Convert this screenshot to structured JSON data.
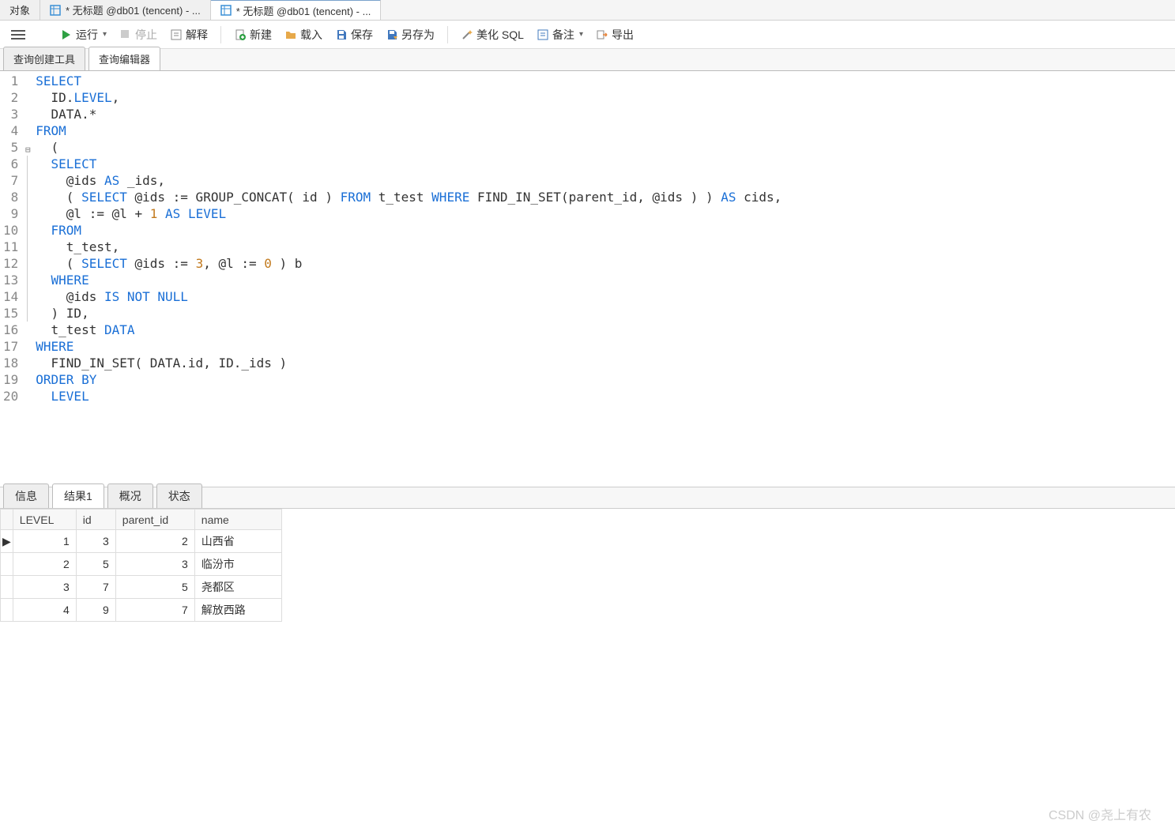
{
  "top_tabs": {
    "t0": "对象",
    "t1": "* 无标题 @db01 (tencent) - ...",
    "t2": "* 无标题 @db01 (tencent) - ..."
  },
  "toolbar": {
    "run": "运行",
    "stop": "停止",
    "explain": "解释",
    "new": "新建",
    "load": "载入",
    "save": "保存",
    "save_as": "另存为",
    "beautify": "美化 SQL",
    "remark": "备注",
    "export": "导出"
  },
  "sub_tabs": {
    "builder": "查询创建工具",
    "editor": "查询编辑器"
  },
  "code_lines": 20,
  "code_tokens": [
    [
      [
        "kw",
        "SELECT"
      ]
    ],
    [
      [
        "txt",
        "  ID."
      ],
      [
        "kw",
        "LEVEL"
      ],
      [
        "txt",
        ","
      ]
    ],
    [
      [
        "txt",
        "  DATA.*"
      ]
    ],
    [
      [
        "kw",
        "FROM"
      ]
    ],
    [
      [
        "txt",
        "  ("
      ]
    ],
    [
      [
        "txt",
        "  "
      ],
      [
        "kw",
        "SELECT"
      ]
    ],
    [
      [
        "txt",
        "    @ids "
      ],
      [
        "kw",
        "AS"
      ],
      [
        "txt",
        " _ids,"
      ]
    ],
    [
      [
        "txt",
        "    ( "
      ],
      [
        "kw",
        "SELECT"
      ],
      [
        "txt",
        " @ids := GROUP_CONCAT( id ) "
      ],
      [
        "kw",
        "FROM"
      ],
      [
        "txt",
        " t_test "
      ],
      [
        "kw",
        "WHERE"
      ],
      [
        "txt",
        " FIND_IN_SET(parent_id, @ids ) ) "
      ],
      [
        "kw",
        "AS"
      ],
      [
        "txt",
        " cids,"
      ]
    ],
    [
      [
        "txt",
        "    @l := @l + "
      ],
      [
        "num",
        "1"
      ],
      [
        "txt",
        " "
      ],
      [
        "kw",
        "AS"
      ],
      [
        "txt",
        " "
      ],
      [
        "kw",
        "LEVEL"
      ]
    ],
    [
      [
        "txt",
        "  "
      ],
      [
        "kw",
        "FROM"
      ]
    ],
    [
      [
        "txt",
        "    t_test,"
      ]
    ],
    [
      [
        "txt",
        "    ( "
      ],
      [
        "kw",
        "SELECT"
      ],
      [
        "txt",
        " @ids := "
      ],
      [
        "num",
        "3"
      ],
      [
        "txt",
        ", @l := "
      ],
      [
        "num",
        "0"
      ],
      [
        "txt",
        " ) b"
      ]
    ],
    [
      [
        "txt",
        "  "
      ],
      [
        "kw",
        "WHERE"
      ]
    ],
    [
      [
        "txt",
        "    @ids "
      ],
      [
        "kw",
        "IS NOT NULL"
      ]
    ],
    [
      [
        "txt",
        "  ) ID,"
      ]
    ],
    [
      [
        "txt",
        "  t_test "
      ],
      [
        "kw",
        "DATA"
      ]
    ],
    [
      [
        "kw",
        "WHERE"
      ]
    ],
    [
      [
        "txt",
        "  FIND_IN_SET( DATA.id, ID._ids )"
      ]
    ],
    [
      [
        "kw",
        "ORDER BY"
      ]
    ],
    [
      [
        "txt",
        "  "
      ],
      [
        "kw",
        "LEVEL"
      ]
    ]
  ],
  "result_tabs": {
    "info": "信息",
    "result1": "结果1",
    "profile": "概况",
    "status": "状态"
  },
  "result": {
    "columns": [
      "LEVEL",
      "id",
      "parent_id",
      "name"
    ],
    "numeric_cols": [
      true,
      true,
      true,
      false
    ],
    "rows": [
      [
        "1",
        "3",
        "2",
        "山西省"
      ],
      [
        "2",
        "5",
        "3",
        "临汾市"
      ],
      [
        "3",
        "7",
        "5",
        "尧都区"
      ],
      [
        "4",
        "9",
        "7",
        "解放西路"
      ]
    ],
    "current_row": 0
  },
  "watermark": "CSDN @尧上有农"
}
